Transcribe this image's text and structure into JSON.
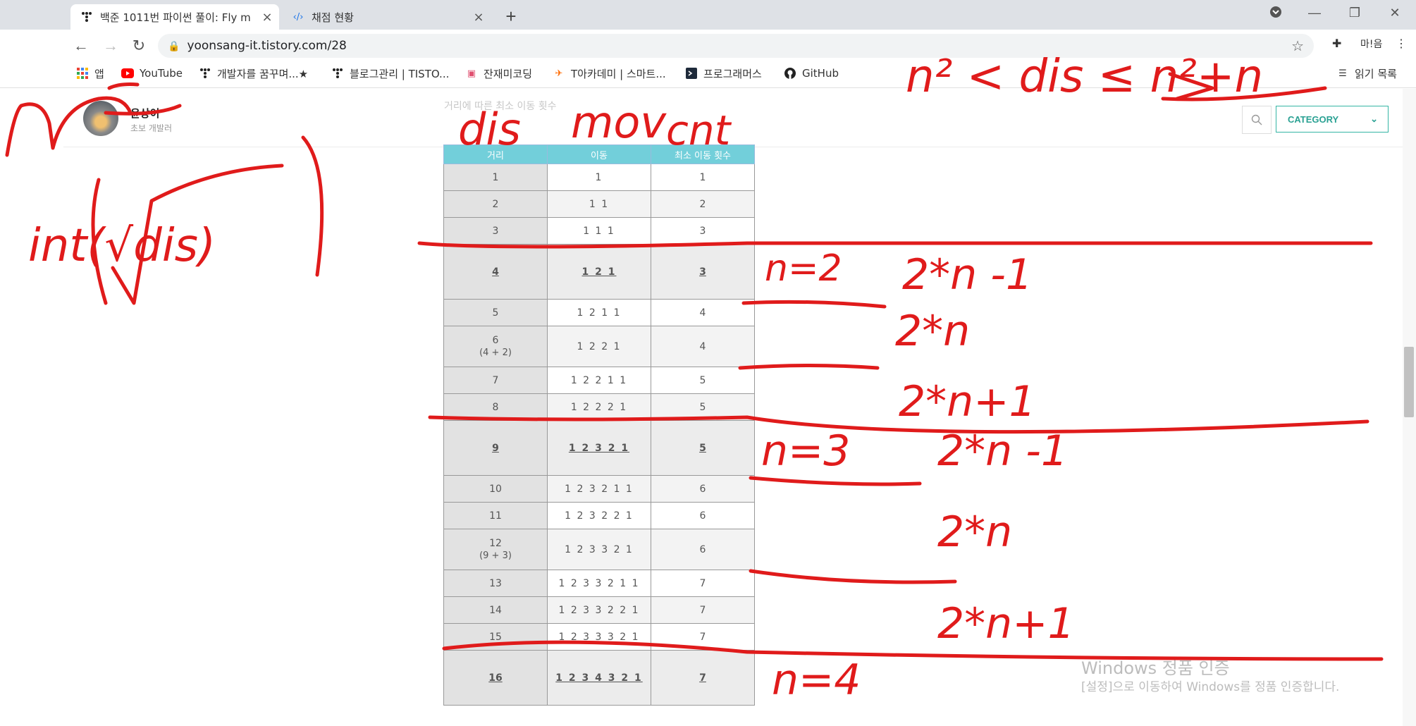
{
  "tabs": [
    {
      "title": "백준 1011번 파이썬 풀이: Fly m",
      "active": true
    },
    {
      "title": "채점 현황",
      "active": false
    }
  ],
  "omnibox": {
    "url": "yoonsang-it.tistory.com/28"
  },
  "toolbar": {
    "profile_label": "마!음"
  },
  "bookmarks": [
    {
      "label": "앱",
      "icon": "apps-grid-icon"
    },
    {
      "label": "YouTube",
      "icon": "youtube-icon"
    },
    {
      "label": "개발자를 꿈꾸며...★",
      "icon": "tistory-icon"
    },
    {
      "label": "블로그관리 | TISTO...",
      "icon": "tistory-icon"
    },
    {
      "label": "잔재미코딩",
      "icon": "bookmark-icon"
    },
    {
      "label": "T아카데미 | 스마트...",
      "icon": "t-academy-icon"
    },
    {
      "label": "프로그래머스",
      "icon": "programmers-icon"
    },
    {
      "label": "GitHub",
      "icon": "github-icon"
    }
  ],
  "reading_list": {
    "label": "읽기 목록"
  },
  "blog": {
    "name": "윤상이",
    "subtitle": "초보 개발러",
    "category_label": "CATEGORY",
    "faded_text": "거리에 따른 최소 이동 횟수"
  },
  "table": {
    "headers": [
      "거리",
      "이동",
      "최소 이동 횟수"
    ],
    "rows": [
      {
        "dist": "1",
        "note": "",
        "moves": "1",
        "count": "1",
        "highlight": false
      },
      {
        "dist": "2",
        "note": "",
        "moves": "1 1",
        "count": "2",
        "highlight": false
      },
      {
        "dist": "3",
        "note": "",
        "moves": "1 1 1",
        "count": "3",
        "highlight": false
      },
      {
        "dist": "4",
        "note": "",
        "moves": "1 2 1",
        "count": "3",
        "highlight": true
      },
      {
        "dist": "5",
        "note": "",
        "moves": "1 2 1 1",
        "count": "4",
        "highlight": false
      },
      {
        "dist": "6",
        "note": "(4 + 2)",
        "moves": "1 2 2 1",
        "count": "4",
        "highlight": false
      },
      {
        "dist": "7",
        "note": "",
        "moves": "1 2 2 1 1",
        "count": "5",
        "highlight": false
      },
      {
        "dist": "8",
        "note": "",
        "moves": "1 2 2 2 1",
        "count": "5",
        "highlight": false
      },
      {
        "dist": "9",
        "note": "",
        "moves": "1 2 3 2 1",
        "count": "5",
        "highlight": true
      },
      {
        "dist": "10",
        "note": "",
        "moves": "1 2 3 2 1 1",
        "count": "6",
        "highlight": false
      },
      {
        "dist": "11",
        "note": "",
        "moves": "1 2 3 2 2 1",
        "count": "6",
        "highlight": false
      },
      {
        "dist": "12",
        "note": "(9 + 3)",
        "moves": "1 2 3 3 2 1",
        "count": "6",
        "highlight": false
      },
      {
        "dist": "13",
        "note": "",
        "moves": "1 2 3 3 2 1 1",
        "count": "7",
        "highlight": false
      },
      {
        "dist": "14",
        "note": "",
        "moves": "1 2 3 3 2 2 1",
        "count": "7",
        "highlight": false
      },
      {
        "dist": "15",
        "note": "",
        "moves": "1 2 3 3 3 2 1",
        "count": "7",
        "highlight": false
      },
      {
        "dist": "16",
        "note": "",
        "moves": "1 2 3 4 3 2 1",
        "count": "7",
        "highlight": true
      }
    ]
  },
  "annotations": {
    "n_label": "n",
    "int_sqrt": "int(√dis)",
    "col_dis": "dis",
    "col_mov": "mov",
    "col_cnt": "cnt",
    "range": "n² < dis ≤ n²+n",
    "n2": "n=2",
    "n3": "n=3",
    "n4": "n=4",
    "f1a": "2*n -1",
    "f2a": "2*n",
    "f3a": "2*n+1",
    "f1b": "2*n -1",
    "f2b": "2*n",
    "f3b": "2*n+1",
    "ink_color": "#e01b1b"
  },
  "watermark": {
    "line1": "Windows 정품 인증",
    "line2": "[설정]으로 이동하여 Windows를 정품 인증합니다."
  }
}
